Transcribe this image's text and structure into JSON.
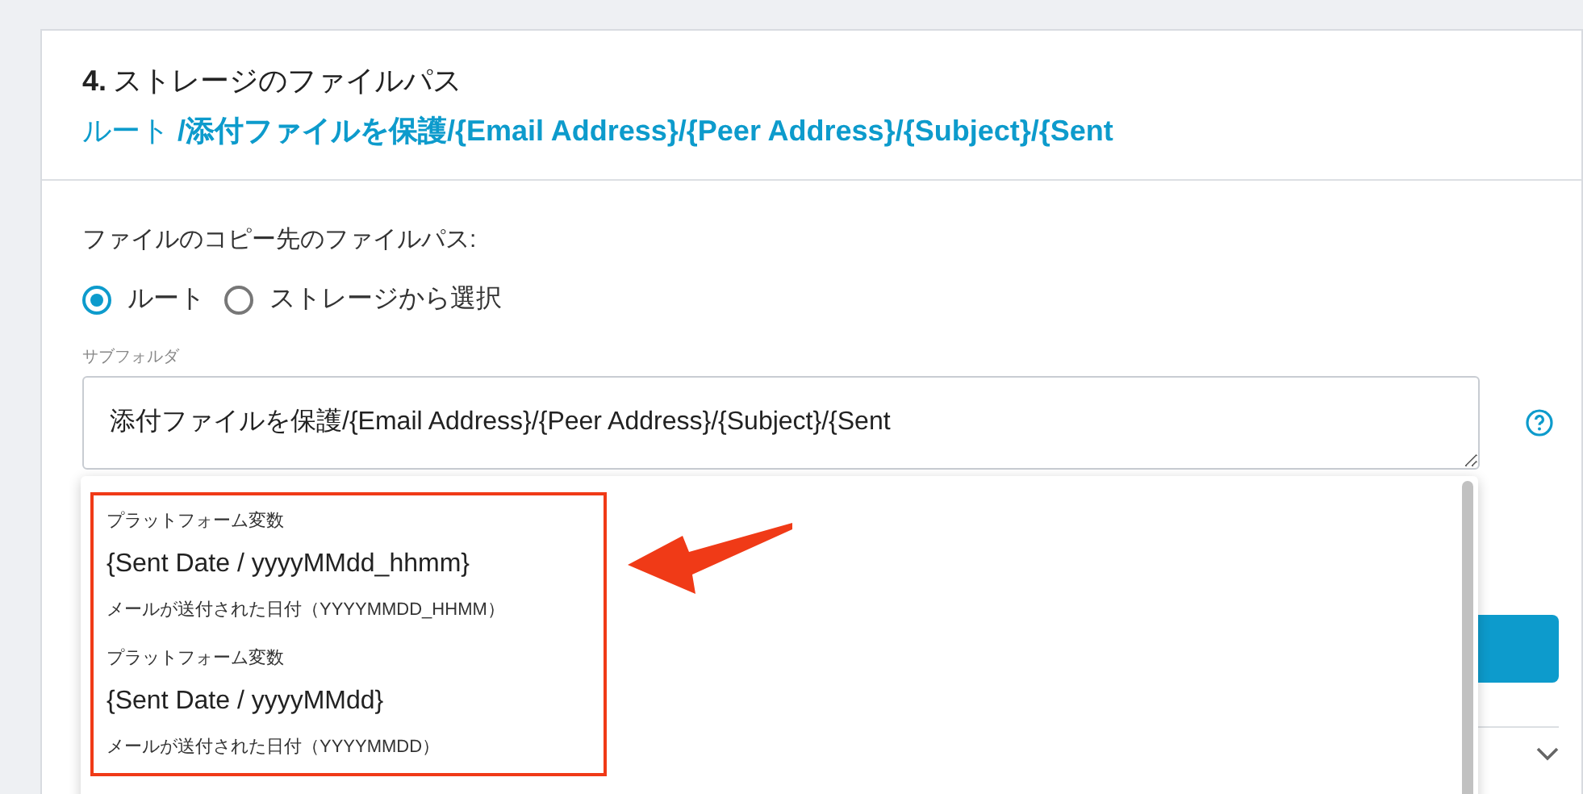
{
  "section": {
    "number": "4.",
    "title": "ストレージのファイルパス",
    "path": "ルート **/添付ファイルを保護/{Email Address}/{Peer Address}/{Subject}/{Sent**"
  },
  "destination": {
    "label": "ファイルのコピー先のファイルパス:",
    "options": [
      {
        "label": "ルート",
        "selected": true
      },
      {
        "label": "ストレージから選択",
        "selected": false
      }
    ]
  },
  "subfolder": {
    "label": "サブフォルダ",
    "value": "添付ファイルを保護/{Email Address}/{Peer Address}/{Subject}/{Sent"
  },
  "suggestions": [
    {
      "category": "プラットフォーム変数",
      "name": "{Sent Date / yyyyMMdd_hhmm}",
      "description": "メールが送付された日付（YYYYMMDD_HHMM）"
    },
    {
      "category": "プラットフォーム変数",
      "name": "{Sent Date / yyyyMMdd}",
      "description": "メールが送付された日付（YYYYMMDD）"
    }
  ]
}
